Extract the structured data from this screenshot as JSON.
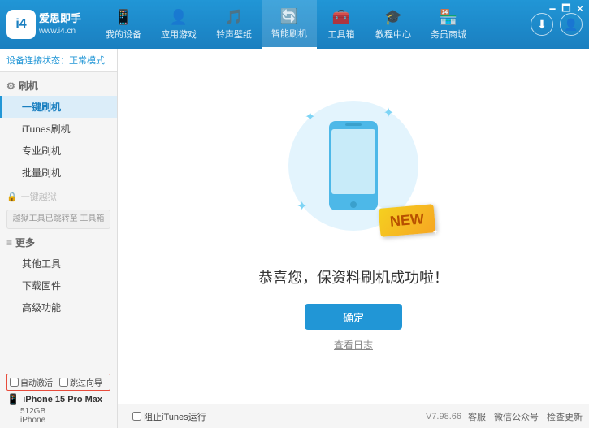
{
  "app": {
    "logo_text_line1": "爱思即手",
    "logo_text_line2": "www.i4.cn",
    "logo_icon": "i4"
  },
  "nav": {
    "tabs": [
      {
        "id": "my-device",
        "label": "我的设备",
        "icon": "📱"
      },
      {
        "id": "apps-games",
        "label": "应用游戏",
        "icon": "👤"
      },
      {
        "id": "ringtones",
        "label": "铃声壁纸",
        "icon": "🎵"
      },
      {
        "id": "smart-flash",
        "label": "智能刷机",
        "icon": "🔄"
      },
      {
        "id": "toolbox",
        "label": "工具箱",
        "icon": "🧰"
      },
      {
        "id": "tutorial",
        "label": "教程中心",
        "icon": "🎓"
      },
      {
        "id": "business",
        "label": "务员商城",
        "icon": "🏪"
      }
    ]
  },
  "sidebar": {
    "status_label": "设备连接状态：",
    "status_value": "正常模式",
    "groups": [
      {
        "id": "flash",
        "icon": "⚙",
        "label": "刷机",
        "items": [
          {
            "id": "one-key-flash",
            "label": "一键刷机",
            "active": true
          },
          {
            "id": "itunes-flash",
            "label": "iTunes刷机"
          },
          {
            "id": "pro-flash",
            "label": "专业刷机"
          },
          {
            "id": "batch-flash",
            "label": "批量刷机"
          }
        ]
      },
      {
        "id": "one-key-jailbreak",
        "disabled": true,
        "label": "一键越狱",
        "notice": "越狱工具已跳转至\n工具箱"
      },
      {
        "id": "more",
        "icon": "≡",
        "label": "更多",
        "items": [
          {
            "id": "other-tools",
            "label": "其他工具"
          },
          {
            "id": "download-firmware",
            "label": "下载固件"
          },
          {
            "id": "advanced",
            "label": "高级功能"
          }
        ]
      }
    ]
  },
  "main": {
    "new_badge": "NEW",
    "success_title": "恭喜您，保资料刷机成功啦！",
    "confirm_button": "确定",
    "view_log": "查看日志",
    "sparkles": [
      "✦",
      "✦",
      "✦"
    ]
  },
  "device": {
    "auto_activate_label": "自动激活",
    "sync_label": "跳过向导",
    "name": "iPhone 15 Pro Max",
    "storage": "512GB",
    "type": "iPhone",
    "phone_icon": "📱"
  },
  "footer": {
    "itunes_label": "阻止iTunes运行",
    "version": "V7.98.66",
    "links": [
      "客服",
      "微信公众号",
      "检查更新"
    ]
  },
  "window_controls": [
    "🗕",
    "🗖",
    "✕"
  ]
}
